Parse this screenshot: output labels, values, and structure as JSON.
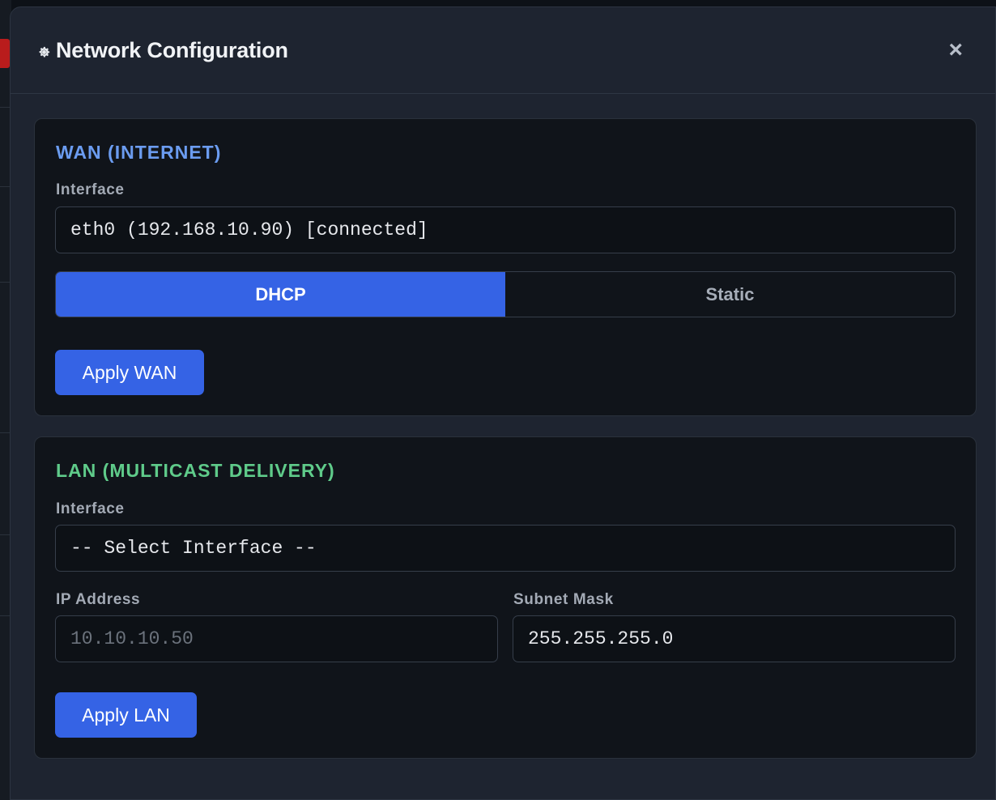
{
  "modal": {
    "title": "Network Configuration",
    "title_icon": "gear-icon",
    "close_glyph": "×"
  },
  "wan": {
    "title": "WAN (INTERNET)",
    "title_color": "#6b9cf0",
    "interface_label": "Interface",
    "interface_value": "eth0 (192.168.10.90) [connected]",
    "modes": [
      "DHCP",
      "Static"
    ],
    "selected_mode": "DHCP",
    "apply_label": "Apply WAN"
  },
  "lan": {
    "title": "LAN (MULTICAST DELIVERY)",
    "title_color": "#5fcb8a",
    "interface_label": "Interface",
    "interface_value": "-- Select Interface --",
    "ip_label": "IP Address",
    "ip_placeholder": "10.10.10.50",
    "ip_value": "",
    "mask_label": "Subnet Mask",
    "mask_value": "255.255.255.0",
    "apply_label": "Apply LAN"
  },
  "colors": {
    "accent": "#3563e5",
    "background": "#1e2430",
    "card": "#10141a"
  }
}
